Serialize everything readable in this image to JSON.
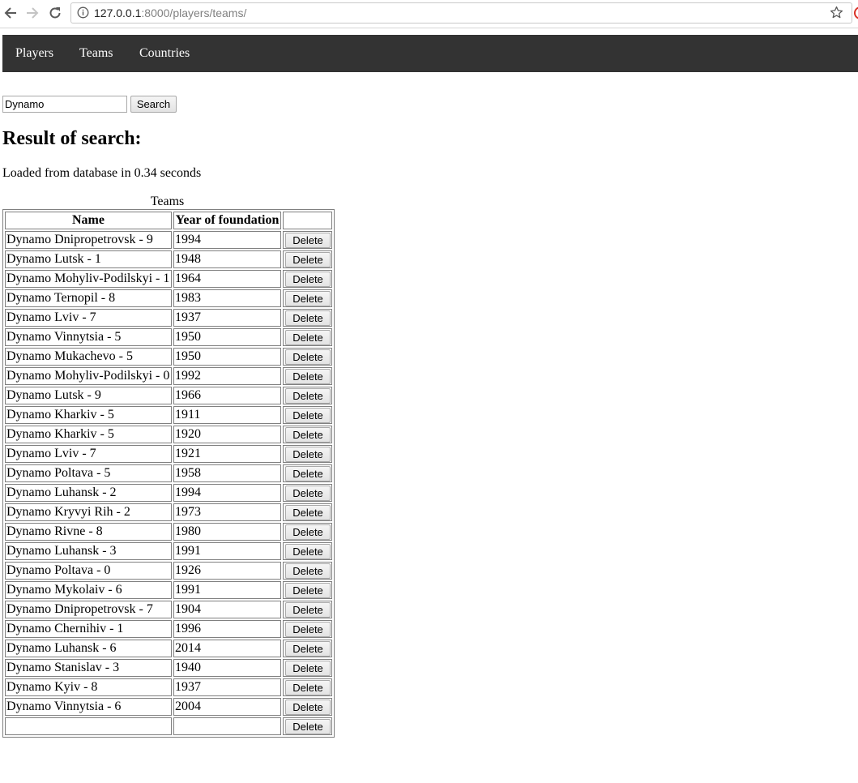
{
  "browser": {
    "url_host": "127.0.0.1",
    "url_path": ":8000/players/teams/"
  },
  "navbar": {
    "items": [
      {
        "label": "Players"
      },
      {
        "label": "Teams"
      },
      {
        "label": "Countries"
      }
    ]
  },
  "search": {
    "value": "Dynamo",
    "button_label": "Search"
  },
  "heading": "Result of search:",
  "status": "Loaded from database in 0.34 seconds",
  "table": {
    "caption": "Teams",
    "headers": [
      "Name",
      "Year of foundation",
      ""
    ],
    "delete_label": "Delete",
    "rows": [
      {
        "name": "Dynamo Dnipropetrovsk - 9",
        "year": "1994"
      },
      {
        "name": "Dynamo Lutsk - 1",
        "year": "1948"
      },
      {
        "name": "Dynamo Mohyliv-Podilskyi - 1",
        "year": "1964"
      },
      {
        "name": "Dynamo Ternopil - 8",
        "year": "1983"
      },
      {
        "name": "Dynamo Lviv - 7",
        "year": "1937"
      },
      {
        "name": "Dynamo Vinnytsia - 5",
        "year": "1950"
      },
      {
        "name": "Dynamo Mukachevo - 5",
        "year": "1950"
      },
      {
        "name": "Dynamo Mohyliv-Podilskyi - 0",
        "year": "1992"
      },
      {
        "name": "Dynamo Lutsk - 9",
        "year": "1966"
      },
      {
        "name": "Dynamo Kharkiv - 5",
        "year": "1911"
      },
      {
        "name": "Dynamo Kharkiv - 5",
        "year": "1920"
      },
      {
        "name": "Dynamo Lviv - 7",
        "year": "1921"
      },
      {
        "name": "Dynamo Poltava - 5",
        "year": "1958"
      },
      {
        "name": "Dynamo Luhansk - 2",
        "year": "1994"
      },
      {
        "name": "Dynamo Kryvyi Rih - 2",
        "year": "1973"
      },
      {
        "name": "Dynamo Rivne - 8",
        "year": "1980"
      },
      {
        "name": "Dynamo Luhansk - 3",
        "year": "1991"
      },
      {
        "name": "Dynamo Poltava - 0",
        "year": "1926"
      },
      {
        "name": "Dynamo Mykolaiv - 6",
        "year": "1991"
      },
      {
        "name": "Dynamo Dnipropetrovsk - 7",
        "year": "1904"
      },
      {
        "name": "Dynamo Chernihiv - 1",
        "year": "1996"
      },
      {
        "name": "Dynamo Luhansk - 6",
        "year": "2014"
      },
      {
        "name": "Dynamo Stanislav - 3",
        "year": "1940"
      },
      {
        "name": "Dynamo Kyiv - 8",
        "year": "1937"
      },
      {
        "name": "Dynamo Vinnytsia - 6",
        "year": "2004"
      },
      {
        "name": "",
        "year": ""
      }
    ]
  }
}
